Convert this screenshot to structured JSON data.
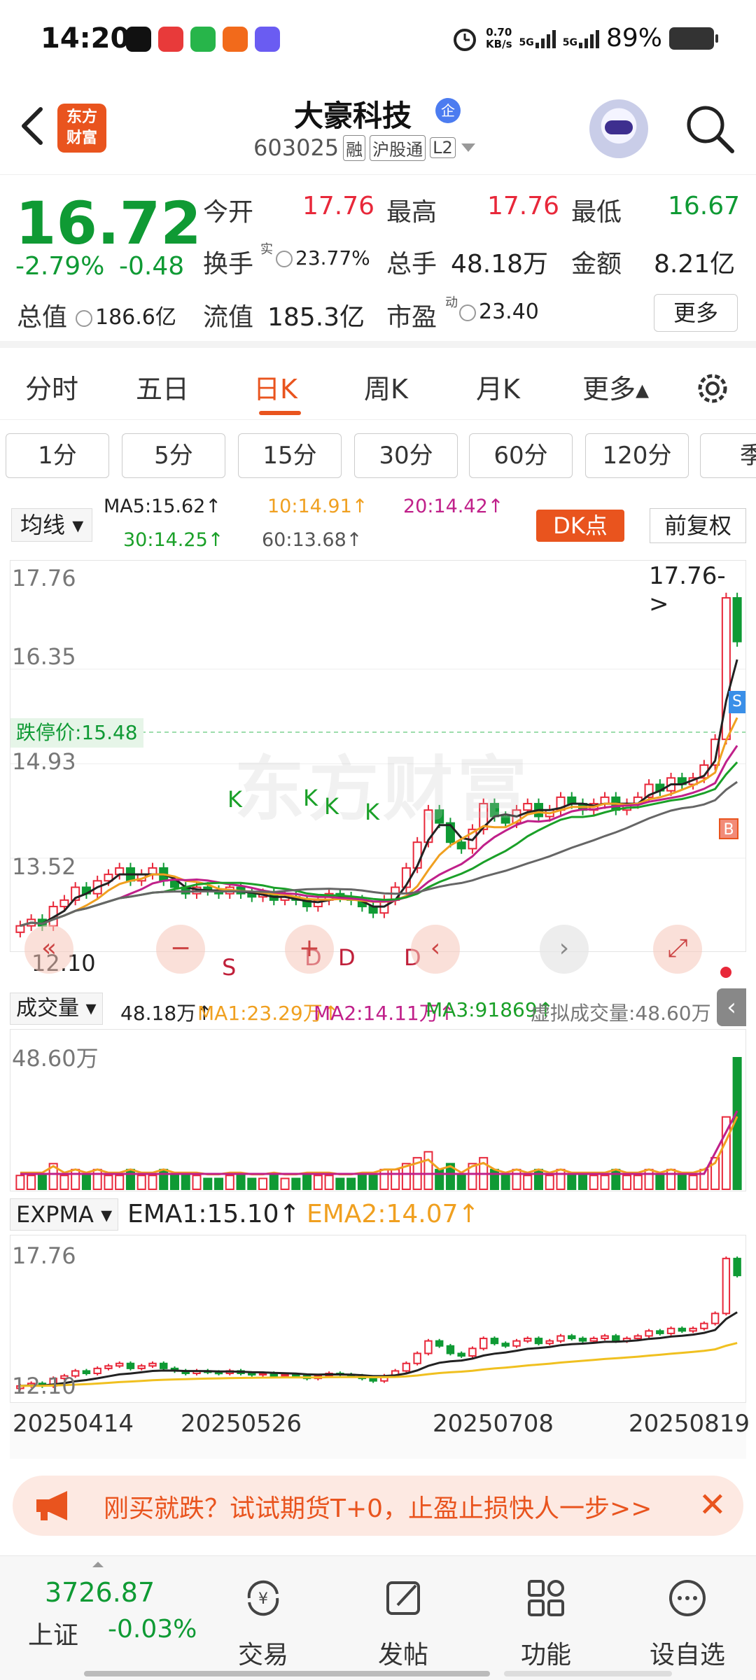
{
  "status_bar": {
    "time": "14:20",
    "net_speed": "0.70",
    "net_unit": "KB/s",
    "sim1": "5G",
    "sim2": "5G",
    "battery": "89%"
  },
  "header": {
    "stock_name": "大豪科技",
    "badge": "企",
    "logo_line1": "东方",
    "logo_line2": "财富",
    "code": "603025",
    "tag_rong": "融",
    "tag_hgt": "沪股通",
    "tag_l2": "L2"
  },
  "quote": {
    "price": "16.72",
    "change_pct": "-2.79%",
    "change": "-0.48",
    "open_label": "今开",
    "open": "17.76",
    "high_label": "最高",
    "high": "17.76",
    "low_label": "最低",
    "low": "16.67",
    "turnover_label": "换手",
    "turnover_sup": "实",
    "turnover": "23.77%",
    "volume_label": "总手",
    "volume": "48.18万",
    "amount_label": "金额",
    "amount": "8.21亿",
    "mktcap_label": "总值",
    "mktcap": "186.6亿",
    "float_label": "流值",
    "float_cap": "185.3亿",
    "pe_label": "市盈",
    "pe_sup": "动",
    "pe": "23.40",
    "more_label": "更多"
  },
  "tabs": [
    "分时",
    "五日",
    "日K",
    "周K",
    "月K",
    "更多▴"
  ],
  "periods": [
    "1分",
    "5分",
    "15分",
    "30分",
    "60分",
    "120分",
    "季"
  ],
  "ma": {
    "selector": "均线",
    "ma5": "MA5:15.62↑",
    "ma10": "10:14.91↑",
    "ma20": "20:14.42↑",
    "ma30": "30:14.25↑",
    "ma60": "60:13.68↑",
    "dk_label": "DK点",
    "fq_label": "前复权",
    "colors": {
      "ma5": "#222222",
      "ma10": "#f0a020",
      "ma20": "#c0208a",
      "ma30": "#1aa028",
      "ma60": "#666666"
    }
  },
  "kline": {
    "y_labels": [
      "17.76",
      "16.35",
      "14.93",
      "13.52",
      "12.10"
    ],
    "top_marker": "17.76->",
    "limit_down": "跌停价:15.48",
    "watermark": "东方财富",
    "signal_letters": [
      "K",
      "S",
      "K",
      "D",
      "K",
      "D",
      "K",
      "D"
    ],
    "bs_marks": [
      "S",
      "B"
    ]
  },
  "volume": {
    "selector": "成交量",
    "vol": "48.18万↑",
    "ma1": "MA1:23.29万↑",
    "ma2": "MA2:14.11万↑",
    "ma3": "MA3:91869↑",
    "virtual": "虚拟成交量:48.60万",
    "max_label": "48.60万"
  },
  "expma": {
    "selector": "EXPMA",
    "ema1": "EMA1:15.10↑",
    "ema2": "EMA2:14.07↑",
    "top_label": "17.76",
    "bottom_label": "12.10"
  },
  "dates": [
    "20250414",
    "20250526",
    "20250708",
    "20250819"
  ],
  "banner": {
    "text": "刚买就跌？试试期货T+0，止盈止损快人一步>>"
  },
  "bottom": {
    "index_value": "3726.87",
    "index_name": "上证",
    "index_change": "-0.03%",
    "nav": [
      "交易",
      "发帖",
      "功能",
      "设自选"
    ]
  },
  "chart_data": {
    "type": "candlestick",
    "y_range": [
      12.1,
      17.76
    ],
    "x_labels": [
      "20250414",
      "20250526",
      "20250708",
      "20250819"
    ],
    "last_candle": {
      "open": 17.76,
      "high": 17.76,
      "low": 16.67,
      "close": 16.72
    },
    "closes": [
      12.3,
      12.4,
      12.3,
      12.6,
      12.7,
      12.9,
      12.8,
      13.0,
      13.1,
      13.2,
      13.0,
      13.1,
      13.2,
      13.0,
      12.9,
      12.8,
      12.9,
      12.85,
      12.8,
      12.9,
      12.8,
      12.75,
      12.8,
      12.7,
      12.75,
      12.7,
      12.6,
      12.7,
      12.8,
      12.75,
      12.7,
      12.6,
      12.5,
      12.7,
      12.9,
      13.2,
      13.6,
      14.1,
      13.9,
      13.6,
      13.5,
      13.8,
      14.2,
      14.0,
      13.9,
      14.1,
      14.2,
      14.0,
      14.1,
      14.3,
      14.2,
      14.1,
      14.2,
      14.3,
      14.1,
      14.2,
      14.3,
      14.5,
      14.4,
      14.6,
      14.5,
      14.6,
      14.8,
      15.2,
      17.4,
      16.72
    ]
  }
}
